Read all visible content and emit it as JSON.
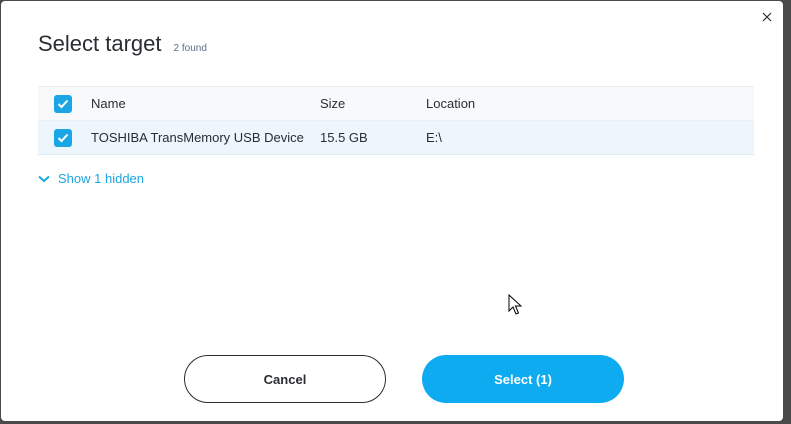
{
  "dialog": {
    "title": "Select target",
    "count_label": "2 found",
    "close_icon": "close-icon"
  },
  "table": {
    "headers": {
      "name": "Name",
      "size": "Size",
      "location": "Location"
    },
    "select_all_checked": true,
    "rows": [
      {
        "checked": true,
        "name": "TOSHIBA TransMemory USB Device",
        "size": "15.5 GB",
        "location": "E:\\"
      }
    ]
  },
  "show_hidden": {
    "label": "Show 1 hidden",
    "icon": "chevron-down-icon"
  },
  "buttons": {
    "cancel": "Cancel",
    "select": "Select (1)"
  },
  "colors": {
    "accent": "#1aa6e4",
    "select_button": "#0eabf0",
    "selected_row": "#ecf6fc",
    "text": "#2a2d33"
  }
}
